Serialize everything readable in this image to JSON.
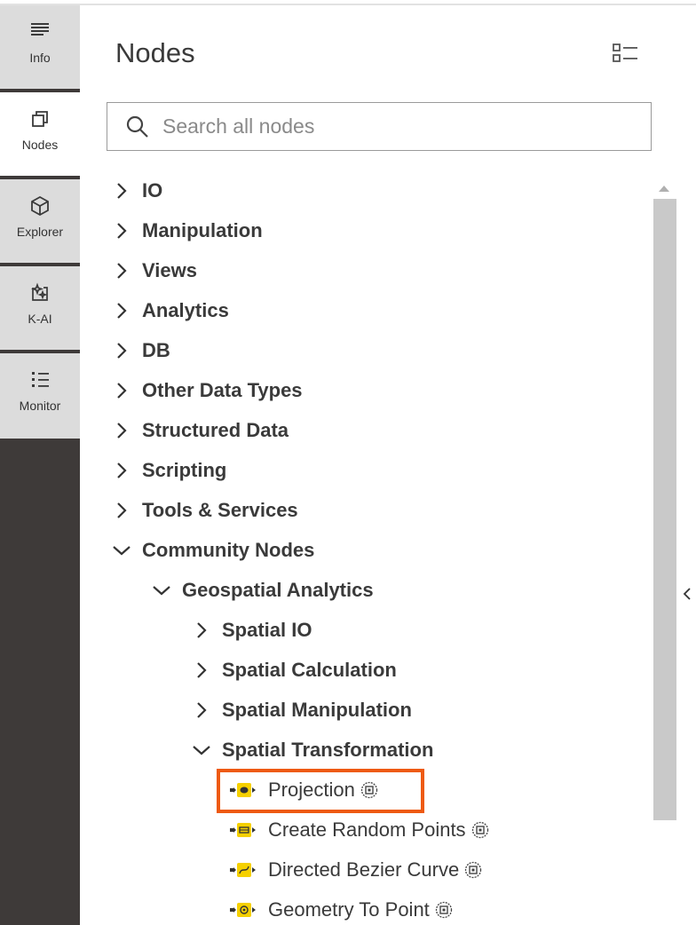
{
  "rail": {
    "tabs": [
      {
        "label": "Info",
        "icon": "info-lines-icon",
        "active": false
      },
      {
        "label": "Nodes",
        "icon": "nodes-cube-icon",
        "active": true
      },
      {
        "label": "Explorer",
        "icon": "explorer-cube-icon",
        "active": false
      },
      {
        "label": "K-AI",
        "icon": "kai-sparkle-icon",
        "active": false
      },
      {
        "label": "Monitor",
        "icon": "monitor-list-icon",
        "active": false
      }
    ]
  },
  "panel": {
    "title": "Nodes",
    "search_placeholder": "Search all nodes"
  },
  "tree": {
    "categories": [
      {
        "label": "IO",
        "expanded": false
      },
      {
        "label": "Manipulation",
        "expanded": false
      },
      {
        "label": "Views",
        "expanded": false
      },
      {
        "label": "Analytics",
        "expanded": false
      },
      {
        "label": "DB",
        "expanded": false
      },
      {
        "label": "Other Data Types",
        "expanded": false
      },
      {
        "label": "Structured Data",
        "expanded": false
      },
      {
        "label": "Scripting",
        "expanded": false
      },
      {
        "label": "Tools & Services",
        "expanded": false
      },
      {
        "label": "Community Nodes",
        "expanded": true
      }
    ],
    "geospatial": {
      "label": "Geospatial Analytics",
      "expanded": true
    },
    "subcategories": [
      {
        "label": "Spatial IO",
        "expanded": false
      },
      {
        "label": "Spatial Calculation",
        "expanded": false
      },
      {
        "label": "Spatial Manipulation",
        "expanded": false
      },
      {
        "label": "Spatial Transformation",
        "expanded": true
      }
    ],
    "nodes": [
      {
        "label": "Projection",
        "icon": "projection-node-icon",
        "highlighted": true
      },
      {
        "label": "Create Random Points",
        "icon": "create-random-points-node-icon",
        "highlighted": false
      },
      {
        "label": "Directed Bezier Curve",
        "icon": "directed-bezier-curve-node-icon",
        "highlighted": false
      },
      {
        "label": "Geometry To Point",
        "icon": "geometry-to-point-node-icon",
        "highlighted": false
      }
    ]
  },
  "colors": {
    "rail_bg": "#3e3a39",
    "tab_bg": "#dcdcdc",
    "active_tab_bg": "#ffffff",
    "node_yellow": "#f5d000",
    "highlight": "#ee5a12",
    "scroll_thumb": "#c9c9c9"
  }
}
